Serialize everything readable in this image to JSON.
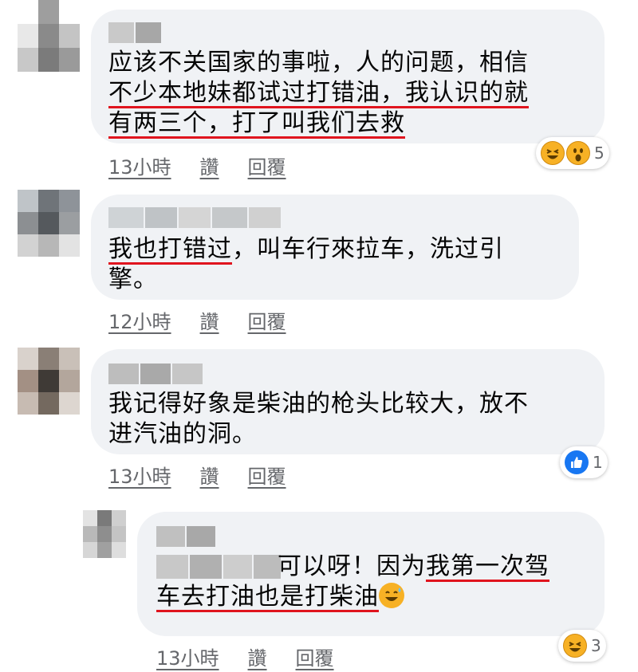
{
  "comments": [
    {
      "lines": [
        [
          {
            "t": "应该不关国家的事啦，人的问题，相信",
            "u": false
          }
        ],
        [
          {
            "t": "不少本地妹都试过打错油，我认识的就",
            "u": true
          }
        ],
        [
          {
            "t": "有两三个，打了叫我们去救",
            "u": true
          }
        ]
      ],
      "time": "13小時",
      "like_label": "讚",
      "reply_label": "回覆",
      "reaction_count": "5",
      "reactions": [
        "laughing-icon",
        "wow-icon"
      ]
    },
    {
      "lines": [
        [
          {
            "t": "我也打错过",
            "u": true
          },
          {
            "t": "，叫车行來拉车，洗过引",
            "u": false
          }
        ],
        [
          {
            "t": "擎。",
            "u": false
          }
        ]
      ],
      "time": "12小時",
      "like_label": "讚",
      "reply_label": "回覆"
    },
    {
      "lines": [
        [
          {
            "t": "我记得好象是柴油的枪头比较大，放不",
            "u": false
          }
        ],
        [
          {
            "t": "进汽油的洞。",
            "u": false
          }
        ]
      ],
      "time": "13小時",
      "like_label": "讚",
      "reply_label": "回覆",
      "reaction_count": "1",
      "reactions": [
        "like-icon"
      ]
    },
    {
      "lines": [
        [
          {
            "t": "可以呀！因为",
            "u": false
          },
          {
            "t": "我第一次驾",
            "u": true
          }
        ],
        [
          {
            "t": "车去打油也是打柴油",
            "u": true
          }
        ]
      ],
      "time": "13小時",
      "like_label": "讚",
      "reply_label": "回覆",
      "reaction_count": "3",
      "reactions": [
        "laughing-icon"
      ],
      "inline_emoji": "sweat-smile-emoji"
    }
  ]
}
